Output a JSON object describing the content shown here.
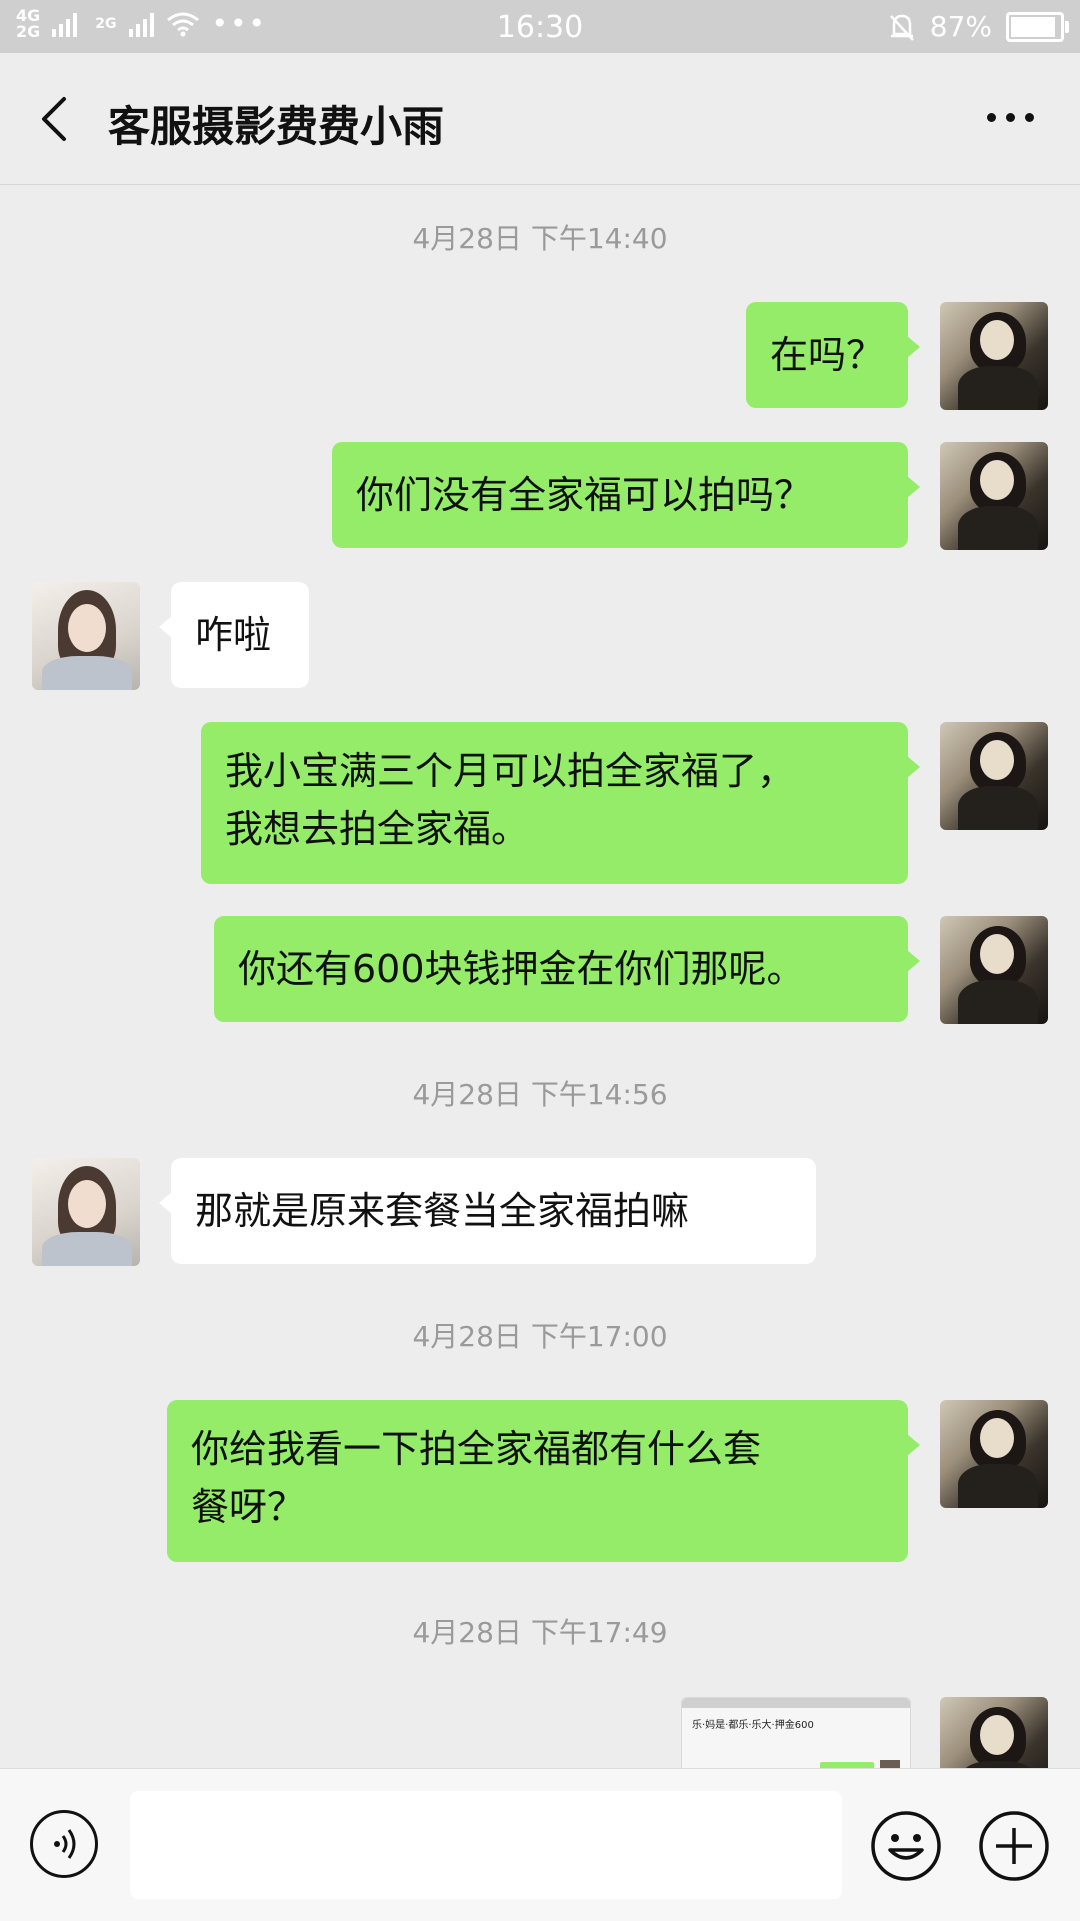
{
  "status_bar": {
    "network_1": "4G",
    "network_2": "2G",
    "network_3": "2G",
    "time": "16:30",
    "battery": "87%"
  },
  "header": {
    "title": "客服摄影费费小雨"
  },
  "messages": [
    {
      "kind": "time",
      "text": "4月28日 下午14:40"
    },
    {
      "kind": "msg",
      "from": "me",
      "text": "在吗？"
    },
    {
      "kind": "msg",
      "from": "me",
      "text": "你们没有全家福可以拍吗？"
    },
    {
      "kind": "msg",
      "from": "cs",
      "text": "咋啦"
    },
    {
      "kind": "msg",
      "from": "me",
      "lines": [
        "我小宝满三个月可以拍全家福了，",
        "我想去拍全家福。"
      ]
    },
    {
      "kind": "msg",
      "from": "me",
      "text": "你还有600块钱押金在你们那呢。"
    },
    {
      "kind": "time",
      "text": "4月28日 下午14:56"
    },
    {
      "kind": "msg",
      "from": "cs",
      "text": "那就是原来套餐当全家福拍嘛"
    },
    {
      "kind": "time",
      "text": "4月28日 下午17:00"
    },
    {
      "kind": "msg",
      "from": "me",
      "lines": [
        "你给我看一下拍全家福都有什么套",
        "餐呀？"
      ]
    },
    {
      "kind": "time",
      "text": "4月28日 下午17:49"
    },
    {
      "kind": "image",
      "from": "me",
      "caption": "乐·妈是·都乐·乐大·押金600"
    }
  ],
  "colors": {
    "my_bubble": "#95ec69",
    "their_bubble": "#ffffff",
    "background": "#ededed"
  },
  "icons": {
    "back": "chevron-left-icon",
    "more": "more-dots-icon",
    "voice": "voice-icon",
    "emoji": "emoji-icon",
    "plus": "plus-icon"
  }
}
